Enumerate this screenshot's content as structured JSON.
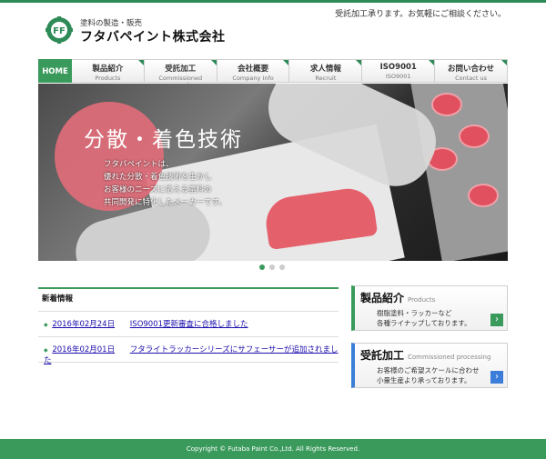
{
  "header": {
    "notice": "受託加工承ります。お気軽にご相談ください。",
    "tagline": "塗料の製造・販売",
    "company": "フタバペイント株式会社",
    "logo_text": "FF"
  },
  "nav": {
    "items": [
      {
        "jp": "HOME",
        "en": ""
      },
      {
        "jp": "製品紹介",
        "en": "Products"
      },
      {
        "jp": "受託加工",
        "en": "Commissioned processing"
      },
      {
        "jp": "会社概要",
        "en": "Company Info"
      },
      {
        "jp": "求人情報",
        "en": "Recruit"
      },
      {
        "jp": "ISO9001",
        "en": "ISO9001"
      },
      {
        "jp": "お問い合わせ",
        "en": "Contact us"
      }
    ],
    "active_index": 0
  },
  "hero": {
    "title": "分散・着色技術",
    "text": "フタバペイントは、\n優れた分散・着色技術を生かし\nお客様のニーズに応える塗料の\n共同開発に特化したメーカーです。"
  },
  "news": {
    "title": "新着情報",
    "items": [
      {
        "date": "2016年02月24日",
        "text": "ISO9001更新審査に合格しました"
      },
      {
        "date": "2016年02月01日",
        "text": "フタライトラッカーシリーズにサフェーサーが追加されました"
      }
    ]
  },
  "side": {
    "products": {
      "title": "製品紹介",
      "en": "Products",
      "desc": "樹脂塗料・ラッカーなど\n各種ライナップしております。"
    },
    "commission": {
      "title": "受託加工",
      "en": "Commissioned processing",
      "desc": "お客様のご希望スケールに合わせ\n小量生産より承っております。"
    }
  },
  "footer": {
    "copyright": "Copyright © Futaba Paint Co.,Ltd. All Rights Reserved."
  },
  "colors": {
    "brand_green": "#3a9a5c",
    "accent_blue": "#3b7dd8",
    "hero_pink": "#e06d78"
  }
}
